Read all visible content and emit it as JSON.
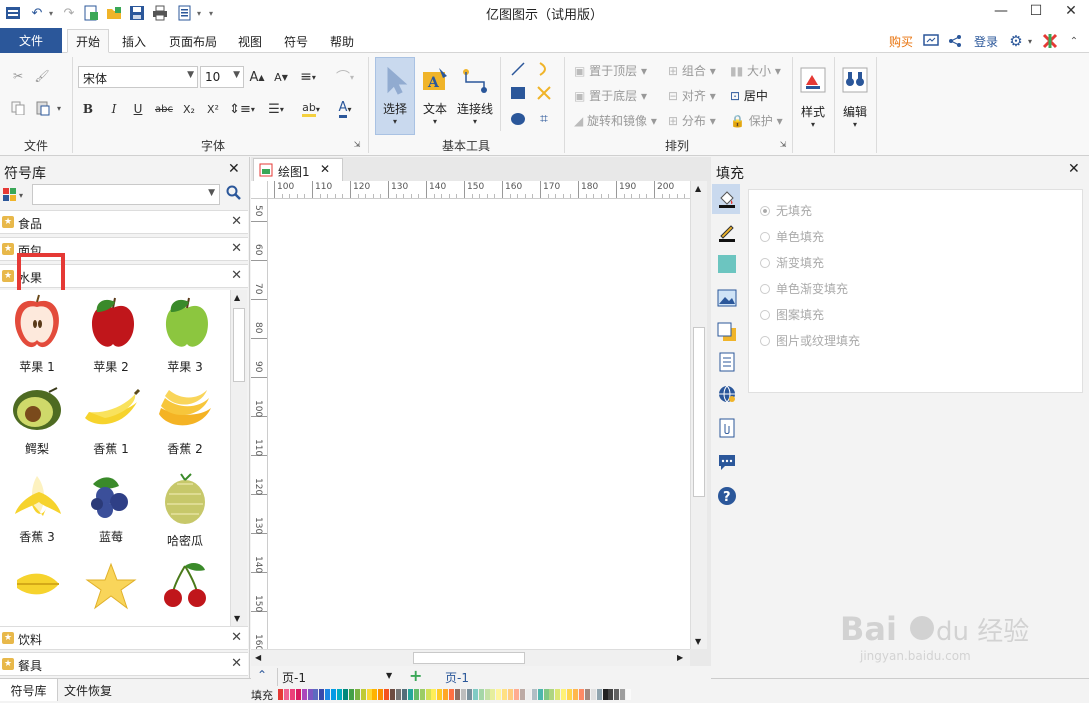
{
  "app": {
    "title": "亿图图示（试用版）",
    "buy": "购买",
    "login": "登录"
  },
  "tabs": [
    "文件",
    "开始",
    "插入",
    "页面布局",
    "视图",
    "符号",
    "帮助"
  ],
  "ribbon": {
    "font_name": "宋体",
    "font_size": "10",
    "groups": {
      "file": "文件",
      "font": "字体",
      "basic_tools": "基本工具",
      "arrange": "排列"
    },
    "tools": {
      "select": "选择",
      "text": "文本",
      "connector": "连接线",
      "style": "样式",
      "edit": "编辑"
    },
    "arrange": {
      "bring_front": "置于顶层",
      "send_back": "置于底层",
      "rotate": "旋转和镜像",
      "group": "组合",
      "align": "对齐",
      "distribute": "分布",
      "size": "大小",
      "center": "居中",
      "protect": "保护"
    },
    "bold": "B",
    "italic": "I",
    "underline": "U",
    "strike": "abc",
    "sub": "X₂",
    "sup": "X²"
  },
  "library": {
    "title": "符号库",
    "categories": [
      "食品",
      "面包",
      "水果"
    ],
    "symbols": [
      "苹果 1",
      "苹果 2",
      "苹果 3",
      "鳄梨",
      "香蕉 1",
      "香蕉 2",
      "香蕉 3",
      "蓝莓",
      "哈密瓜"
    ],
    "bottom_categories": [
      "饮料",
      "餐具"
    ],
    "bottom_tabs": [
      "符号库",
      "文件恢复"
    ]
  },
  "document": {
    "tab": "绘图1",
    "hruler": [
      "100",
      "110",
      "120",
      "130",
      "140",
      "150",
      "160",
      "170",
      "180",
      "190",
      "200"
    ],
    "vruler": [
      "50",
      "60",
      "70",
      "80",
      "90",
      "100",
      "110",
      "120",
      "130",
      "140",
      "150",
      "160"
    ],
    "page_select": "页-1",
    "page_tab": "页-1",
    "fill_label": "填充"
  },
  "fill_panel": {
    "title": "填充",
    "options": [
      "无填充",
      "单色填充",
      "渐变填充",
      "单色渐变填充",
      "图案填充",
      "图片或纹理填充"
    ]
  },
  "colors": {
    "file_tab": "#2b579a",
    "buy": "#e8730c",
    "highlight": "#e53935"
  }
}
